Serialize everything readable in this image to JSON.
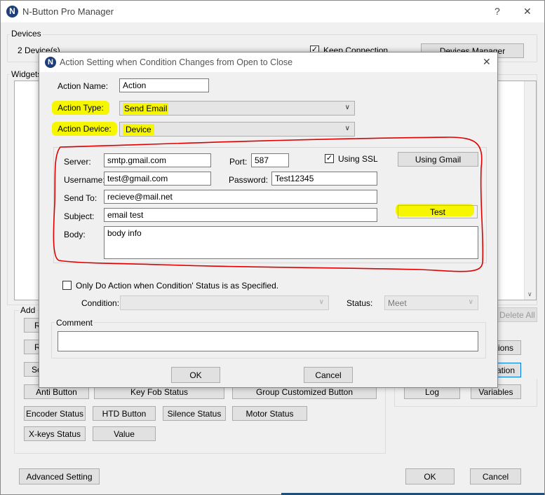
{
  "main": {
    "title": "N-Button Pro Manager",
    "help_label": "?",
    "close_label": "✕",
    "devices_group": "Devices",
    "device_count": "2 Device(s)",
    "keep_connection": "Keep Connection",
    "devices_manager": "Devices Manager",
    "widgets_group": "Widgets",
    "add_group": "Add",
    "delete_all": "Delete All",
    "right_buttons": [
      "ions",
      "ation",
      "Log",
      "Variables"
    ],
    "add_buttons_row_a": [
      "Anti Button",
      "Key Fob Status",
      "Group Customized Button"
    ],
    "add_buttons_row_b": [
      "Encoder Status",
      "HTD Button",
      "Silence Status",
      "Motor Status"
    ],
    "add_buttons_row_c": [
      "X-keys Status",
      "Value"
    ],
    "advanced_setting": "Advanced Setting",
    "ok": "OK",
    "cancel": "Cancel"
  },
  "dialog": {
    "title": "Action Setting when Condition Changes from Open to Close",
    "close_label": "✕",
    "action_name_label": "Action Name:",
    "action_name_value": "Action",
    "action_type_label": "Action Type:",
    "action_type_value": "Send Email",
    "action_device_label": "Action Device:",
    "action_device_value": "Device",
    "server_label": "Server:",
    "server_value": "smtp.gmail.com",
    "port_label": "Port:",
    "port_value": "587",
    "using_ssl_label": "Using SSL",
    "using_gmail": "Using Gmail",
    "username_label": "Username:",
    "username_value": "test@gmail.com",
    "password_label": "Password:",
    "password_value": "Test12345",
    "sendto_label": "Send To:",
    "sendto_value": "recieve@mail.net",
    "subject_label": "Subject:",
    "subject_value": "email test",
    "test_button": "Test",
    "body_label": "Body:",
    "body_value": "body info",
    "only_do_label": "Only Do Action when Condition' Status is as Specified.",
    "condition_label": "Condition:",
    "condition_value": "",
    "status_label": "Status:",
    "status_value": "Meet",
    "comment_label": "Comment",
    "comment_value": "",
    "ok": "OK",
    "cancel": "Cancel"
  },
  "colors": {
    "highlight": "#f6f600",
    "annotation": "#e00000",
    "dialog_border": "#8a8a8a"
  }
}
